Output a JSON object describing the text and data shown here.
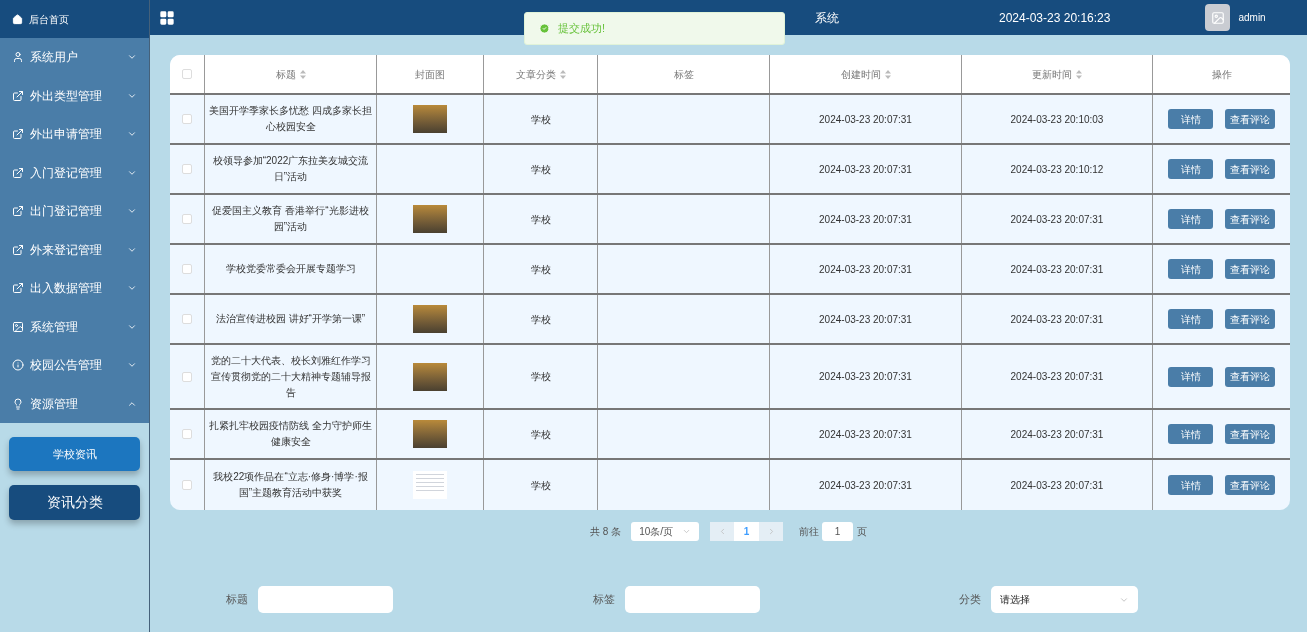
{
  "sidebar": {
    "home": "后台首页",
    "items": [
      {
        "label": "系统用户",
        "kind": "user",
        "expanded": false
      },
      {
        "label": "外出类型管理",
        "kind": "share",
        "expanded": false
      },
      {
        "label": "外出申请管理",
        "kind": "share",
        "expanded": false
      },
      {
        "label": "入门登记管理",
        "kind": "share",
        "expanded": false
      },
      {
        "label": "出门登记管理",
        "kind": "share",
        "expanded": false
      },
      {
        "label": "外来登记管理",
        "kind": "share",
        "expanded": false
      },
      {
        "label": "出入数据管理",
        "kind": "share",
        "expanded": false
      },
      {
        "label": "系统管理",
        "kind": "image",
        "expanded": false
      },
      {
        "label": "校园公告管理",
        "kind": "info",
        "expanded": false
      },
      {
        "label": "资源管理",
        "kind": "bulb",
        "expanded": true,
        "children": [
          {
            "label": "学校资讯",
            "selected": true
          },
          {
            "label": "资讯分类",
            "selected": false
          }
        ]
      }
    ]
  },
  "header": {
    "title": "系统",
    "datetime": "2024-03-23 20:16:23",
    "user": "admin"
  },
  "toast": {
    "message": "提交成功!"
  },
  "table": {
    "select_all_checked": false,
    "columns": [
      {
        "label": "标题",
        "sortable": true
      },
      {
        "label": "封面图",
        "sortable": false
      },
      {
        "label": "文章分类",
        "sortable": true
      },
      {
        "label": "标签",
        "sortable": false
      },
      {
        "label": "创建时间",
        "sortable": true
      },
      {
        "label": "更新时间",
        "sortable": true
      },
      {
        "label": "操作",
        "sortable": false
      }
    ],
    "rows": [
      {
        "checked": false,
        "title": "美国开学季家长多忧愁 四成多家长担心校园安全",
        "cover": {
          "kind": "photo"
        },
        "category": "学校",
        "created": "2024-03-23 20:07:31",
        "updated": "2024-03-23 20:10:03",
        "actions": [
          "详情",
          "查看评论"
        ]
      },
      {
        "checked": false,
        "title": "校领导参加“2022广东拉美友城交流日”活动",
        "category": "学校",
        "created": "2024-03-23 20:07:31",
        "updated": "2024-03-23 20:10:12",
        "actions": [
          "详情",
          "查看评论"
        ]
      },
      {
        "checked": false,
        "title": "促爱国主义教育 香港举行“光影进校园”活动",
        "cover": {
          "kind": "photo"
        },
        "category": "学校",
        "created": "2024-03-23 20:07:31",
        "updated": "2024-03-23 20:07:31",
        "actions": [
          "详情",
          "查看评论"
        ]
      },
      {
        "checked": false,
        "title": "学校党委常委会开展专题学习",
        "category": "学校",
        "created": "2024-03-23 20:07:31",
        "updated": "2024-03-23 20:07:31",
        "actions": [
          "详情",
          "查看评论"
        ]
      },
      {
        "checked": false,
        "title": "法治宣传进校园 讲好“开学第一课”",
        "cover": {
          "kind": "photo"
        },
        "category": "学校",
        "created": "2024-03-23 20:07:31",
        "updated": "2024-03-23 20:07:31",
        "actions": [
          "详情",
          "查看评论"
        ]
      },
      {
        "checked": false,
        "title": "党的二十大代表、校长刘雅红作学习宣传贯彻党的二十大精神专题辅导报告",
        "cover": {
          "kind": "photo"
        },
        "category": "学校",
        "created": "2024-03-23 20:07:31",
        "updated": "2024-03-23 20:07:31",
        "actions": [
          "详情",
          "查看评论"
        ]
      },
      {
        "checked": false,
        "title": "扎紧扎牢校园疫情防线 全力守护师生健康安全",
        "cover": {
          "kind": "photo"
        },
        "category": "学校",
        "created": "2024-03-23 20:07:31",
        "updated": "2024-03-23 20:07:31",
        "actions": [
          "详情",
          "查看评论"
        ]
      },
      {
        "checked": false,
        "title": "我校22项作品在“立志·修身·博学·报国”主题教育活动中获奖",
        "cover": {
          "kind": "document"
        },
        "category": "学校",
        "created": "2024-03-23 20:07:31",
        "updated": "2024-03-23 20:07:31",
        "actions": [
          "详情",
          "查看评论"
        ]
      }
    ]
  },
  "pagination": {
    "total": "共 8 条",
    "page_size": "10条/页",
    "pages": [
      {
        "label": "1",
        "selected": true
      }
    ],
    "goto_label": "前往",
    "goto_value": "1",
    "goto_suffix": "页"
  },
  "form": [
    {
      "label": "标题",
      "kind": "input"
    },
    {
      "label": "标签",
      "kind": "input"
    },
    {
      "label": "分类",
      "kind": "select",
      "value": "请选择"
    }
  ]
}
